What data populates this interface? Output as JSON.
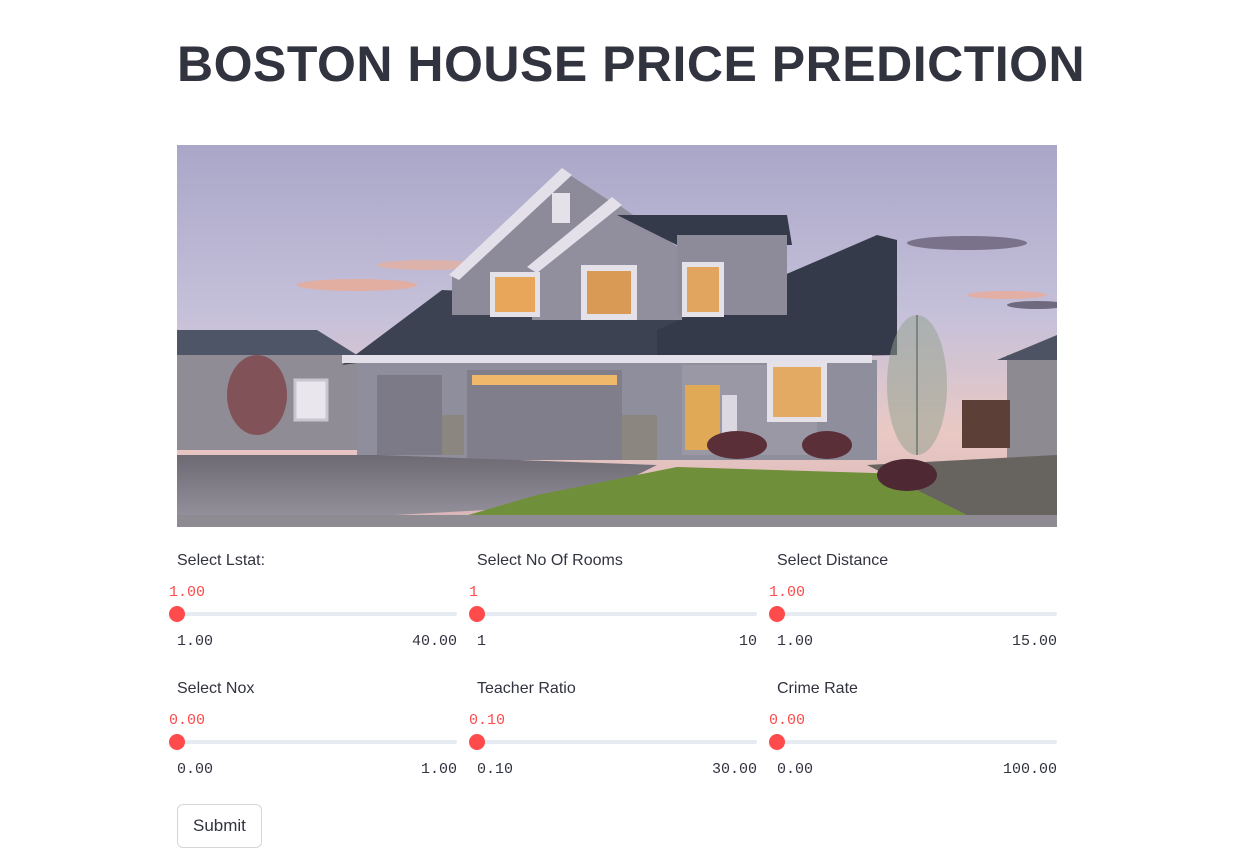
{
  "page": {
    "title": "BOSTON HOUSE PRICE PREDICTION"
  },
  "colors": {
    "accent": "#ff4b4b",
    "text": "#31333f",
    "track": "#e6eaf1"
  },
  "sliders": [
    {
      "label": "Select Lstat:",
      "value": "1.00",
      "min": "1.00",
      "max": "40.00",
      "fraction": 0
    },
    {
      "label": "Select No Of Rooms",
      "value": "1",
      "min": "1",
      "max": "10",
      "fraction": 0
    },
    {
      "label": "Select Distance",
      "value": "1.00",
      "min": "1.00",
      "max": "15.00",
      "fraction": 0
    },
    {
      "label": "Select Nox",
      "value": "0.00",
      "min": "0.00",
      "max": "1.00",
      "fraction": 0
    },
    {
      "label": "Teacher Ratio",
      "value": "0.10",
      "min": "0.10",
      "max": "30.00",
      "fraction": 0
    },
    {
      "label": "Crime Rate",
      "value": "0.00",
      "min": "0.00",
      "max": "100.00",
      "fraction": 0
    }
  ],
  "submit": {
    "label": "Submit"
  }
}
